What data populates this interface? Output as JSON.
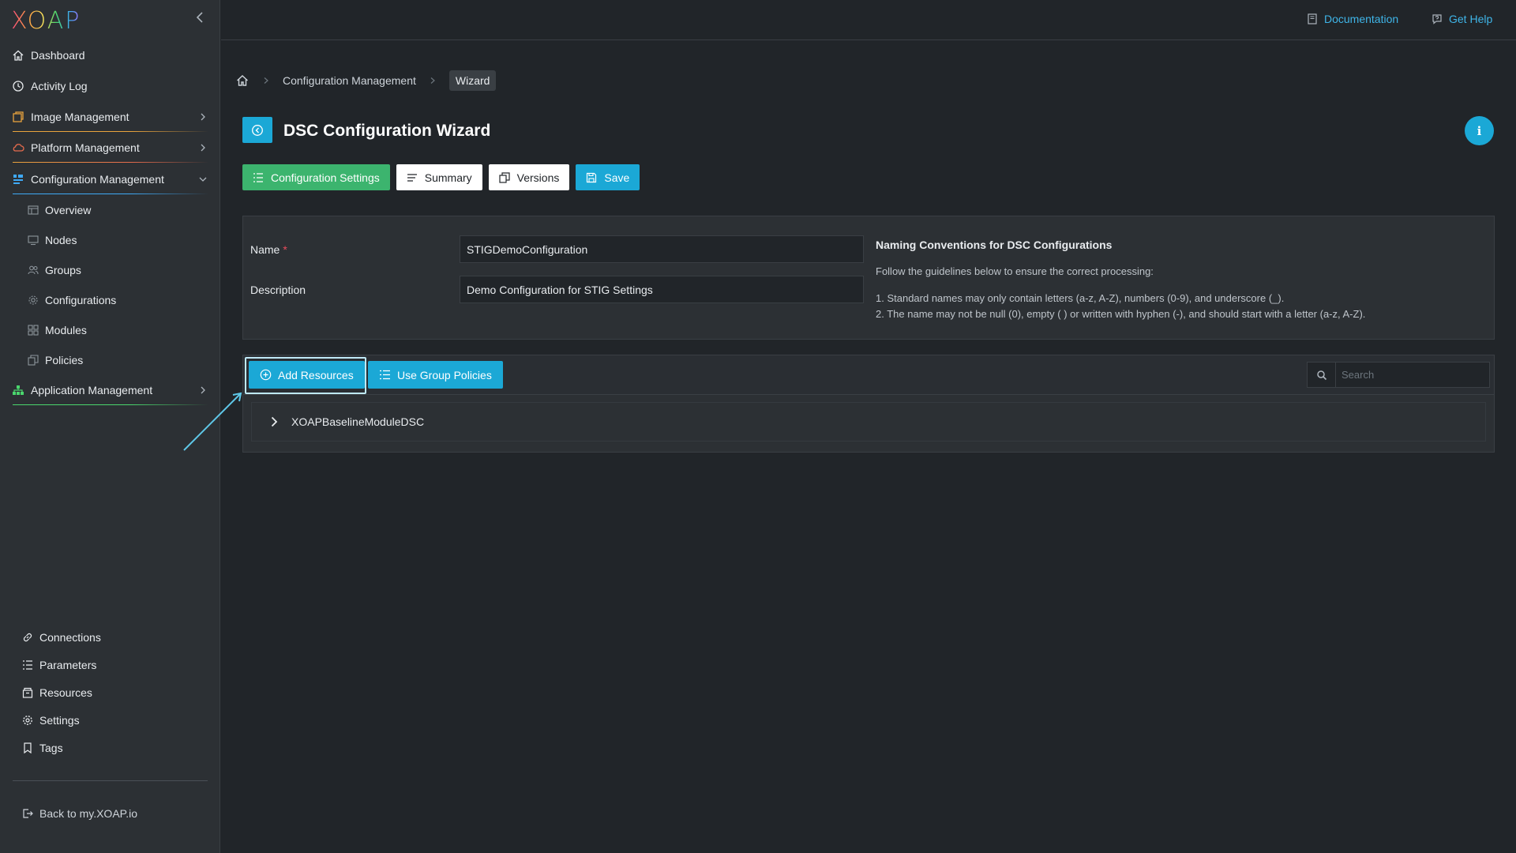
{
  "app": {
    "logo_text": "XOAP"
  },
  "topbar": {
    "documentation": "Documentation",
    "get_help": "Get Help"
  },
  "sidebar": {
    "items": [
      {
        "label": "Dashboard",
        "icon": "home-icon"
      },
      {
        "label": "Activity Log",
        "icon": "clock-icon"
      },
      {
        "label": "Image Management",
        "icon": "image-icon"
      },
      {
        "label": "Platform Management",
        "icon": "cloud-icon"
      },
      {
        "label": "Configuration Management",
        "icon": "config-icon"
      },
      {
        "label": "Application Management",
        "icon": "sitemap-icon"
      }
    ],
    "sub_items": [
      {
        "label": "Overview",
        "icon": "overview-icon"
      },
      {
        "label": "Nodes",
        "icon": "monitor-icon"
      },
      {
        "label": "Groups",
        "icon": "users-icon"
      },
      {
        "label": "Configurations",
        "icon": "gear-icon"
      },
      {
        "label": "Modules",
        "icon": "grid-icon"
      },
      {
        "label": "Policies",
        "icon": "copy-icon"
      }
    ],
    "bottom_items": [
      {
        "label": "Connections",
        "icon": "link-icon"
      },
      {
        "label": "Parameters",
        "icon": "list-icon"
      },
      {
        "label": "Resources",
        "icon": "box-icon"
      },
      {
        "label": "Settings",
        "icon": "settings-icon"
      },
      {
        "label": "Tags",
        "icon": "bookmark-icon"
      }
    ],
    "back_link": "Back to my.XOAP.io",
    "underline_colors": [
      "#e8a33d",
      "#e8a33d",
      "#3fa9f5",
      "#4ad66d"
    ]
  },
  "breadcrumb": {
    "items": [
      "Configuration Management"
    ],
    "current": "Wizard"
  },
  "header": {
    "title": "DSC Configuration Wizard",
    "info": "i"
  },
  "toolbar": {
    "config_settings": "Configuration Settings",
    "summary": "Summary",
    "versions": "Versions",
    "save": "Save"
  },
  "form": {
    "name_label": "Name",
    "name_required": "*",
    "name_value": "STIGDemoConfiguration",
    "description_label": "Description",
    "description_value": "Demo Configuration for STIG Settings",
    "guidelines_title": "Naming Conventions for DSC Configurations",
    "guidelines_intro": "Follow the guidelines below to ensure the correct processing:",
    "guideline_1": "1. Standard names may only contain letters (a-z, A-Z), numbers (0-9), and underscore (_).",
    "guideline_2": "2. The name may not be null (0), empty ( ) or written with hyphen (-), and should start with a letter (a-z, A-Z)."
  },
  "resources": {
    "add_resources": "Add Resources",
    "use_group_policies": "Use Group Policies",
    "search_placeholder": "Search",
    "tree_items": [
      "XOAPBaselineModuleDSC"
    ]
  },
  "colors": {
    "accent_blue": "#1ba8d6",
    "accent_green": "#3cb46e",
    "link_blue": "#3fb5e8",
    "required_red": "#e74c5c"
  }
}
